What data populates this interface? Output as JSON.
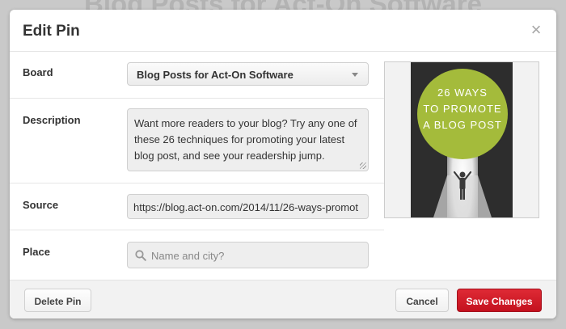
{
  "background": {
    "page_title": "Blog Posts for Act-On Software"
  },
  "dialog": {
    "title": "Edit Pin",
    "close_glyph": "×"
  },
  "form": {
    "board": {
      "label": "Board",
      "value": "Blog Posts for Act-On Software"
    },
    "description": {
      "label": "Description",
      "value": "Want more readers to your blog? Try any one of these 26 techniques for promoting your latest blog post, and see your readership jump."
    },
    "source": {
      "label": "Source",
      "value": "https://blog.act-on.com/2014/11/26-ways-promot"
    },
    "place": {
      "label": "Place",
      "placeholder": "Name and city?"
    }
  },
  "pin_image": {
    "line1": "26 WAYS",
    "line2": "TO PROMOTE",
    "line3": "A BLOG POST",
    "circle_color": "#a4bb3b"
  },
  "footer": {
    "delete_label": "Delete Pin",
    "cancel_label": "Cancel",
    "save_label": "Save Changes"
  },
  "colors": {
    "accent_red": "#cb1f27",
    "page_background": "#c9c9c9"
  }
}
